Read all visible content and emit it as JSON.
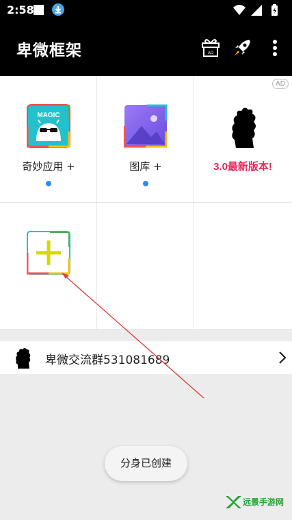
{
  "status_bar": {
    "time": "2:58"
  },
  "app_bar": {
    "title": "卑微框架",
    "gift_badge": "AD",
    "icons": [
      "gift-ad-icon",
      "rocket-icon",
      "more-vertical-icon"
    ]
  },
  "grid": {
    "ad_badge": "AD",
    "items": [
      {
        "label": "奇妙应用 +",
        "icon_text": "MAGIC",
        "dot": true
      },
      {
        "label": "图库 +",
        "dot": true
      },
      {
        "label": "3.0最新版本!",
        "dot": false
      },
      {
        "label": "",
        "icon": "add-app-icon"
      }
    ]
  },
  "group": {
    "label": "卑微交流群531081689"
  },
  "toast": {
    "text": "分身已创建"
  },
  "watermark": {
    "text": "远景手游网"
  },
  "colors": {
    "app_bar": "#000000",
    "accent_dot": "#2c8cf4",
    "red_label": "#e8265a",
    "plus": "#d8d800",
    "arrow": "#d9453a"
  }
}
